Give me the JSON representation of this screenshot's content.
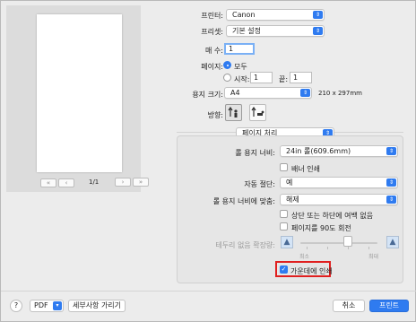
{
  "printer": {
    "label": "프린터:",
    "value": "Canon"
  },
  "preset": {
    "label": "프리셋:",
    "value": "기본 설정"
  },
  "copies": {
    "label": "매 수:",
    "value": "1"
  },
  "pages": {
    "label": "페이지:",
    "all_label": "모두",
    "from_label": "시작:",
    "from_value": "1",
    "to_label": "끝:",
    "to_value": "1"
  },
  "paper_size": {
    "label": "용지 크기:",
    "value": "A4",
    "dims": "210 x 297mm"
  },
  "orientation": {
    "label": "방향:"
  },
  "preview": {
    "page_count": "1/1",
    "first": "«",
    "prev": "‹",
    "next": "›",
    "last": "»"
  },
  "section_popup": {
    "value": "페이지 처리"
  },
  "roll_width": {
    "label": "롤 용지 너비:",
    "value": "24in 롤(609.6mm)"
  },
  "banner_print": {
    "label": "배너 인쇄"
  },
  "auto_cut": {
    "label": "자동 절단:",
    "value": "예"
  },
  "fit_roll": {
    "label": "롤 용지 너비에 맞춤:",
    "value": "해제"
  },
  "no_margin_top_bottom": {
    "label": "상단 또는 하단에 여백 없음"
  },
  "rotate_90": {
    "label": "페이지를 90도 회전"
  },
  "borderless_ext": {
    "label": "테두리 없음 확장량:",
    "min_label": "최소",
    "max_label": "최대",
    "level": 0.6
  },
  "center_print": {
    "label": "가운데에 인쇄",
    "checked": true
  },
  "footer": {
    "help": "?",
    "pdf": "PDF",
    "hide_details": "세부사항 가리기",
    "cancel": "취소",
    "print": "프린트"
  },
  "colors": {
    "accent": "#2f7bf0",
    "highlight": "#e01f1f"
  }
}
